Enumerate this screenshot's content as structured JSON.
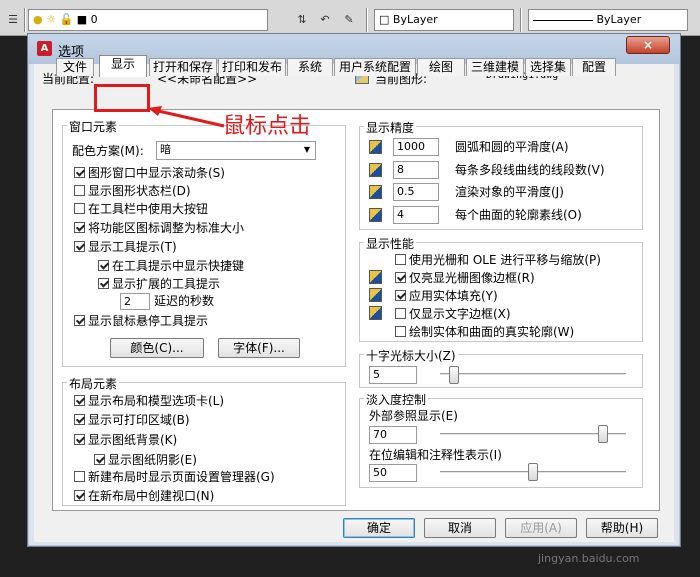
{
  "toolbar": {
    "layer_value": "0",
    "color_value": "ByLayer",
    "linetype_value": "ByLayer"
  },
  "dialog": {
    "title": "选项",
    "close_symbol": "×",
    "current_profile_label": "当前配置:",
    "current_profile_value": "<<未命名配置>>",
    "current_drawing_label": "当前图形:",
    "current_drawing_value": "Drawing1.dwg"
  },
  "tabs": [
    {
      "label": "文件"
    },
    {
      "label": "显示"
    },
    {
      "label": "打开和保存"
    },
    {
      "label": "打印和发布"
    },
    {
      "label": "系统"
    },
    {
      "label": "用户系统配置"
    },
    {
      "label": "绘图"
    },
    {
      "label": "三维建模"
    },
    {
      "label": "选择集"
    },
    {
      "label": "配置"
    }
  ],
  "window_elements": {
    "title": "窗口元素",
    "color_scheme_label": "配色方案(M):",
    "color_scheme_value": "暗",
    "checkboxes": [
      {
        "label": "图形窗口中显示滚动条(S)",
        "checked": true
      },
      {
        "label": "显示图形状态栏(D)",
        "checked": false
      },
      {
        "label": "在工具栏中使用大按钮",
        "checked": false
      },
      {
        "label": "将功能区图标调整为标准大小",
        "checked": true
      },
      {
        "label": "显示工具提示(T)",
        "checked": true
      },
      {
        "label": "在工具提示中显示快捷键",
        "checked": true
      },
      {
        "label": "显示扩展的工具提示",
        "checked": true
      }
    ],
    "delay_value": "2",
    "delay_label": "延迟的秒数",
    "hover_tooltip": {
      "label": "显示鼠标悬停工具提示",
      "checked": true
    },
    "colors_button": "颜色(C)...",
    "fonts_button": "字体(F)..."
  },
  "layout_elements": {
    "title": "布局元素",
    "checkboxes": [
      {
        "label": "显示布局和模型选项卡(L)",
        "checked": true
      },
      {
        "label": "显示可打印区域(B)",
        "checked": true
      },
      {
        "label": "显示图纸背景(K)",
        "checked": true
      },
      {
        "label": "显示图纸阴影(E)",
        "checked": true
      },
      {
        "label": "新建布局时显示页面设置管理器(G)",
        "checked": false
      },
      {
        "label": "在新布局中创建视口(N)",
        "checked": true
      }
    ]
  },
  "display_resolution": {
    "title": "显示精度",
    "rows": [
      {
        "value": "1000",
        "label": "圆弧和圆的平滑度(A)"
      },
      {
        "value": "8",
        "label": "每条多段线曲线的线段数(V)"
      },
      {
        "value": "0.5",
        "label": "渲染对象的平滑度(J)"
      },
      {
        "value": "4",
        "label": "每个曲面的轮廓素线(O)"
      }
    ]
  },
  "display_performance": {
    "title": "显示性能",
    "checkboxes": [
      {
        "label": "使用光栅和 OLE 进行平移与缩放(P)",
        "checked": false
      },
      {
        "label": "仅亮显光栅图像边框(R)",
        "checked": true
      },
      {
        "label": "应用实体填充(Y)",
        "checked": true
      },
      {
        "label": "仅显示文字边框(X)",
        "checked": false
      },
      {
        "label": "绘制实体和曲面的真实轮廓(W)",
        "checked": false
      }
    ]
  },
  "crosshair": {
    "title": "十字光标大小(Z)",
    "value": "5",
    "slider_fraction": 0.05
  },
  "fade_control": {
    "title": "淡入度控制",
    "xref_label": "外部参照显示(E)",
    "xref_value": "70",
    "xref_fraction": 0.9,
    "inplace_label": "在位编辑和注释性表示(I)",
    "inplace_value": "50",
    "inplace_fraction": 0.5
  },
  "buttons": {
    "ok": "确定",
    "cancel": "取消",
    "apply": "应用(A)",
    "help": "帮助(H)"
  },
  "annotation": {
    "text": "鼠标点击"
  },
  "watermark": {
    "site": "jingyan.baidu.com"
  }
}
